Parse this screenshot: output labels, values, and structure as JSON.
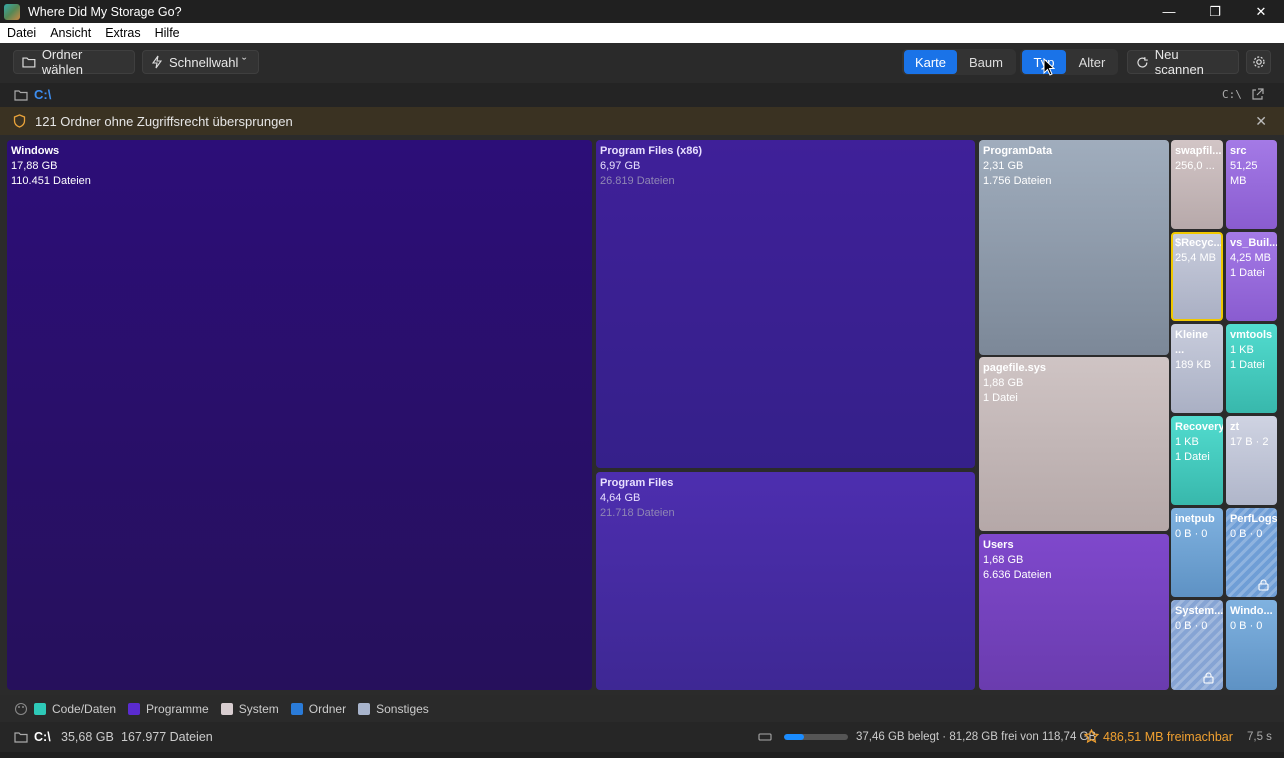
{
  "window": {
    "title": "Where Did My Storage Go?",
    "controls": [
      "—",
      "❐",
      "✕"
    ]
  },
  "menu": [
    "Datei",
    "Ansicht",
    "Extras",
    "Hilfe"
  ],
  "toolbar": {
    "choose_folder": "Ordner wählen",
    "quick_select": "Schnellwahl ˇ",
    "view_map": "Karte",
    "view_tree": "Baum",
    "color_type": "Typ",
    "color_age": "Alter",
    "rescan": "Neu scannen"
  },
  "path": {
    "current": "C:\\",
    "drive": "C:\\"
  },
  "warning": {
    "text": "121 Ordner ohne Zugriffsrecht übersprungen"
  },
  "treemap": [
    {
      "name": "Windows",
      "size": "17,88 GB",
      "files": "110.451 Dateien",
      "color": "#2a0d6e"
    },
    {
      "name": "Program Files (x86)",
      "size": "6,97 GB",
      "files": "26.819 Dateien",
      "color": "#3a1f94"
    },
    {
      "name": "Program Files",
      "size": "4,64 GB",
      "files": "21.718 Dateien",
      "color": "#4a2aa8"
    },
    {
      "name": "ProgramData",
      "size": "2,31 GB",
      "files": "1.756 Dateien",
      "color": "#8c9cb0"
    },
    {
      "name": "pagefile.sys",
      "size": "1,88 GB",
      "files": "1 Datei",
      "color": "#c8bcbc"
    },
    {
      "name": "Users",
      "size": "1,68 GB",
      "files": "6.636 Dateien",
      "color": "#7a45c4"
    },
    {
      "name": "swapfil...",
      "size": "256,0 ...",
      "files": "",
      "color": "#cdbfc0"
    },
    {
      "name": "src",
      "size": "51,25 MB",
      "files": "",
      "color": "#9b6fe0"
    },
    {
      "name": "$Recyc...",
      "size": "25,4 MB",
      "files": "",
      "color": "#c4c8d8"
    },
    {
      "name": "vs_Buil...",
      "size": "4,25 MB",
      "files": "1 Datei",
      "color": "#9b6fe0"
    },
    {
      "name": "Kleine ...",
      "size": "189 KB",
      "files": "",
      "color": "#c4c8d8"
    },
    {
      "name": "vmtools",
      "size": "1 KB",
      "files": "1 Datei",
      "color": "#48d6c8"
    },
    {
      "name": "Recovery",
      "size": "1 KB",
      "files": "1 Datei",
      "color": "#48d6c8"
    },
    {
      "name": "zt",
      "size": "17 B · 2",
      "files": "",
      "color": "#c4c8d8"
    },
    {
      "name": "inetpub",
      "size": "0 B · 0",
      "files": "",
      "color": "#78aad8"
    },
    {
      "name": "PerfLogs",
      "size": "0 B · 0",
      "files": "",
      "color": "#78aad8"
    },
    {
      "name": "System...",
      "size": "0 B · 0",
      "files": "",
      "color": "#8ca8d8"
    },
    {
      "name": "Windo...",
      "size": "0 B · 0",
      "files": "",
      "color": "#78aad8"
    }
  ],
  "legend": [
    {
      "label": "Code/Daten",
      "color": "#2ec9b8"
    },
    {
      "label": "Programme",
      "color": "#5a2bd0"
    },
    {
      "label": "System",
      "color": "#d8cdd0"
    },
    {
      "label": "Ordner",
      "color": "#2a7bd8"
    },
    {
      "label": "Sonstiges",
      "color": "#a8b4cc"
    }
  ],
  "status": {
    "path": "C:\\",
    "total": "35,68 GB",
    "files": "167.977 Dateien",
    "disk_used_fraction": 0.315,
    "disk_text": "37,46 GB belegt · 81,28 GB frei von 118,74 GB",
    "freeable": "486,51 MB freimachbar",
    "time": "7,5 s"
  }
}
